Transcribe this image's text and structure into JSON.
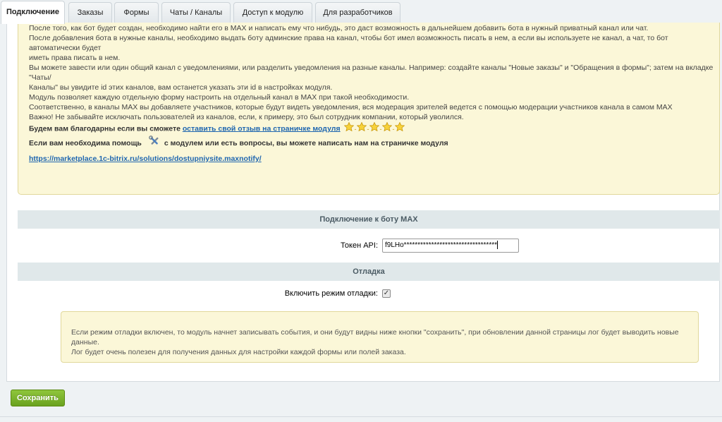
{
  "tabs": [
    {
      "label": "Подключение",
      "active": true
    },
    {
      "label": "Заказы"
    },
    {
      "label": "Формы"
    },
    {
      "label": "Чаты / Каналы"
    },
    {
      "label": "Доступ к модулю"
    },
    {
      "label": "Для разработчиков"
    }
  ],
  "notes": {
    "cut_line": "После того, как бот будет создан, необходимо найти его в MAX и написать ему что нибудь, это даст возможность в дальнейшем добавить бота в нужный приватный канал или чат.",
    "para1_line1": "После добавления бота в нужные каналы, необходимо выдать боту админские права на канал, чтобы бот имел возможность писать в нем, а если вы используете не канал, а чат, то бот автоматически будет",
    "para1_line2": "иметь права писать в нем.",
    "para2_line1": "Вы можете завести или один общий канал с уведомлениями, или разделить уведомления на разные каналы. Например: создайте каналы \"Новые заказы\" и \"Обращения в формы\"; затем на вкладке \"Чаты/",
    "para2_line2": "Каналы\" вы увидите id этих каналов, вам останется указать эти id в настройках модуля.",
    "para2_line3": "Модуль позволяет каждую отдельную форму настроить на отдельный канал в MAX при такой необходимости.",
    "para2_line4": "Соответственно, в каналы MAX вы добавляете участников, которые будут видеть уведомления, вся модерация зрителей ведется с помощью модерации участников канала в самом MAX",
    "warning": "Важно! Не забывайте исключать пользователей из каналов, если, к примеру, это был сотрудник компании, который уволился.",
    "review_text": "Будем вам благодарны если вы сможете",
    "review_link": "оставить свой отзыв на страничке модуля",
    "help_text_before": "Если вам необходима помощь",
    "help_text_after": "с модулем или есть вопросы, вы можете написать нам на страничке модуля",
    "help_link": "https://marketplace.1c-bitrix.ru/solutions/dostupniysite.maxnotify/"
  },
  "connection": {
    "heading": "Подключение к боту MAX",
    "token_label": "Токен API:",
    "token_value": "f9LHo**********************************"
  },
  "debug": {
    "heading": "Отладка",
    "checkbox_label": "Включить режим отладки:",
    "checked": true,
    "note_line1": "Если режим отладки включен, то модуль начнет записывать события, и они будут видны ниже кнопки \"сохранить\", при обновлении данной страницы лог будет выводить новые данные.",
    "note_line2": "Лог будет очень полезен для получения данных для настройки каждой формы или полей заказа."
  },
  "footer": {
    "save_label": "Сохранить"
  },
  "icons": {
    "stars": "star-icon",
    "tools": "tools-icon",
    "check": "checkmark-icon"
  },
  "colors": {
    "note_bg": "#fbf7d8",
    "section_bg": "#e0e8ea",
    "link": "#2067b0",
    "save_button": "#7ab22b"
  }
}
